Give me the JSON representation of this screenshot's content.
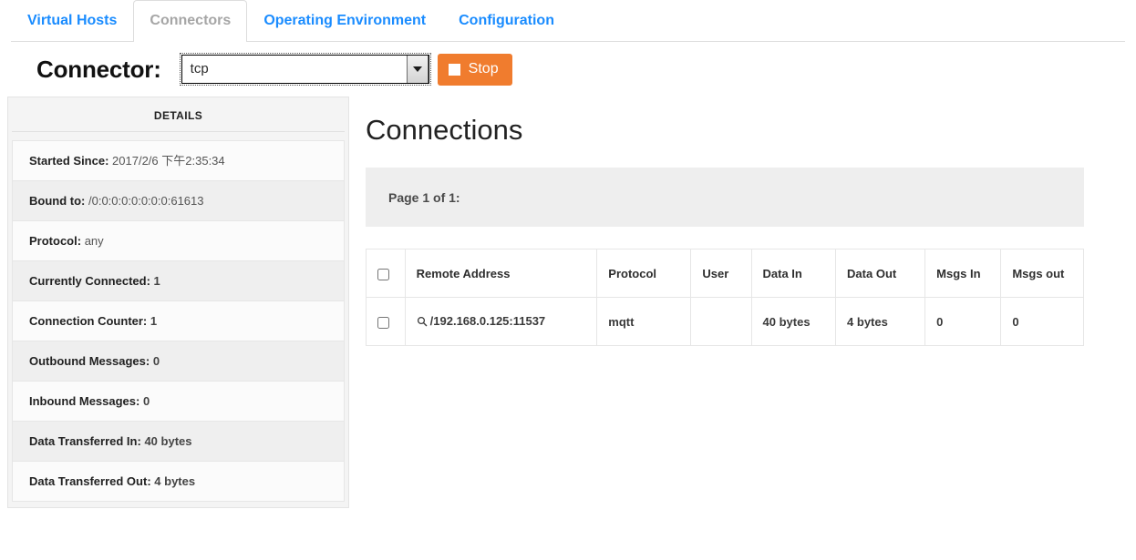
{
  "nav": {
    "tabs": [
      {
        "label": "Virtual Hosts",
        "active": false
      },
      {
        "label": "Connectors",
        "active": true
      },
      {
        "label": "Operating Environment",
        "active": false
      },
      {
        "label": "Configuration",
        "active": false
      }
    ]
  },
  "connector_bar": {
    "label": "Connector:",
    "select": {
      "value": "tcp",
      "options": [
        "tcp"
      ],
      "icon": "chevron-down-icon"
    },
    "stop_button": {
      "label": "Stop",
      "icon": "stop-square-icon",
      "color": "#f07c2e"
    }
  },
  "details": {
    "title": "DETAILS",
    "rows": [
      {
        "key": "Started Since:",
        "value": "2017/2/6 下午2:35:34"
      },
      {
        "key": "Bound to:",
        "value": "/0:0:0:0:0:0:0:0:61613"
      },
      {
        "key": "Protocol:",
        "value": "any"
      },
      {
        "key": "Currently Connected:",
        "value": "1"
      },
      {
        "key": "Connection Counter:",
        "value": "1"
      },
      {
        "key": "Outbound Messages:",
        "value": "0"
      },
      {
        "key": "Inbound Messages:",
        "value": "0"
      },
      {
        "key": "Data Transferred In:",
        "value": "40 bytes"
      },
      {
        "key": "Data Transferred Out:",
        "value": "4 bytes"
      }
    ]
  },
  "connections": {
    "title": "Connections",
    "page_info": "Page 1 of 1:",
    "columns": [
      "Remote Address",
      "Protocol",
      "User",
      "Data In",
      "Data Out",
      "Msgs In",
      "Msgs out"
    ],
    "rows": [
      {
        "remote_address": "/192.168.0.125:11537",
        "remote_address_icon": "magnifier-icon",
        "protocol": "mqtt",
        "user": "",
        "data_in": "40 bytes",
        "data_out": "4 bytes",
        "msgs_in": "0",
        "msgs_out": "0"
      }
    ]
  },
  "colors": {
    "link_blue": "#1a8cff",
    "accent_orange": "#f07c2e",
    "panel_gray": "#f4f4f4",
    "pageinfo_gray": "#eeeeee"
  }
}
